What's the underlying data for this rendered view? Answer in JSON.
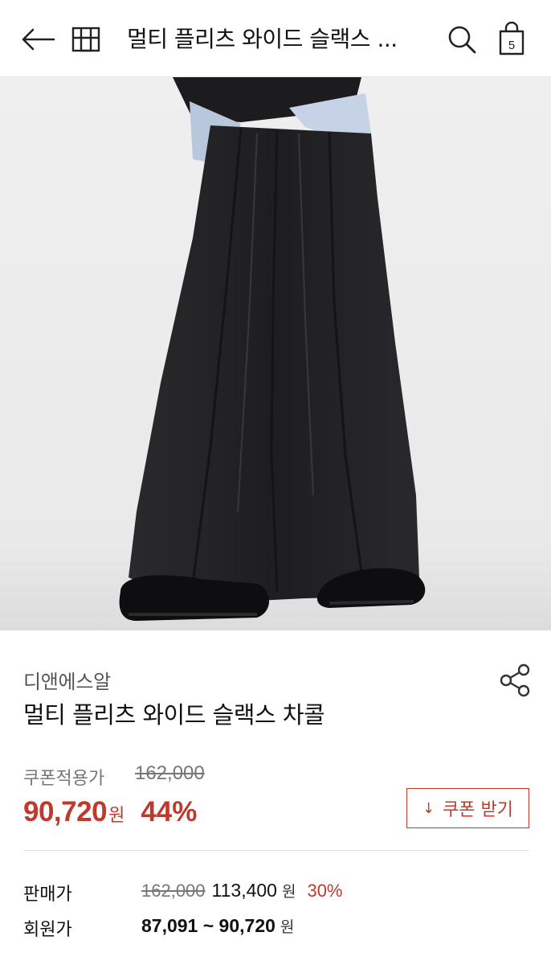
{
  "header": {
    "title": "멀티 플리츠 와이드 슬랙스 ...",
    "cart_count": "5",
    "icons": [
      "back-arrow-icon",
      "home-icon",
      "search-icon",
      "shopping-bag-icon"
    ]
  },
  "product": {
    "brand": "디앤에스알",
    "name": "멀티 플리츠 와이드 슬랙스 차콜"
  },
  "coupon": {
    "label": "쿠폰적용가",
    "original_price": "162,000",
    "price": "90,720",
    "currency": "원",
    "discount": "44%",
    "button_label": "쿠폰 받기",
    "button_icon": "download-arrow-icon"
  },
  "details": {
    "sale": {
      "label": "판매가",
      "original": "162,000",
      "price": "113,400",
      "unit": "원",
      "discount": "30%"
    },
    "member": {
      "label": "회원가",
      "range": "87,091 ~ 90,720",
      "unit": "원"
    }
  },
  "colors": {
    "accent": "#c0392b",
    "muted": "#777777",
    "divider": "#e2e2e2",
    "photo_bg": "#ececec",
    "pants": "#1e1e21"
  }
}
